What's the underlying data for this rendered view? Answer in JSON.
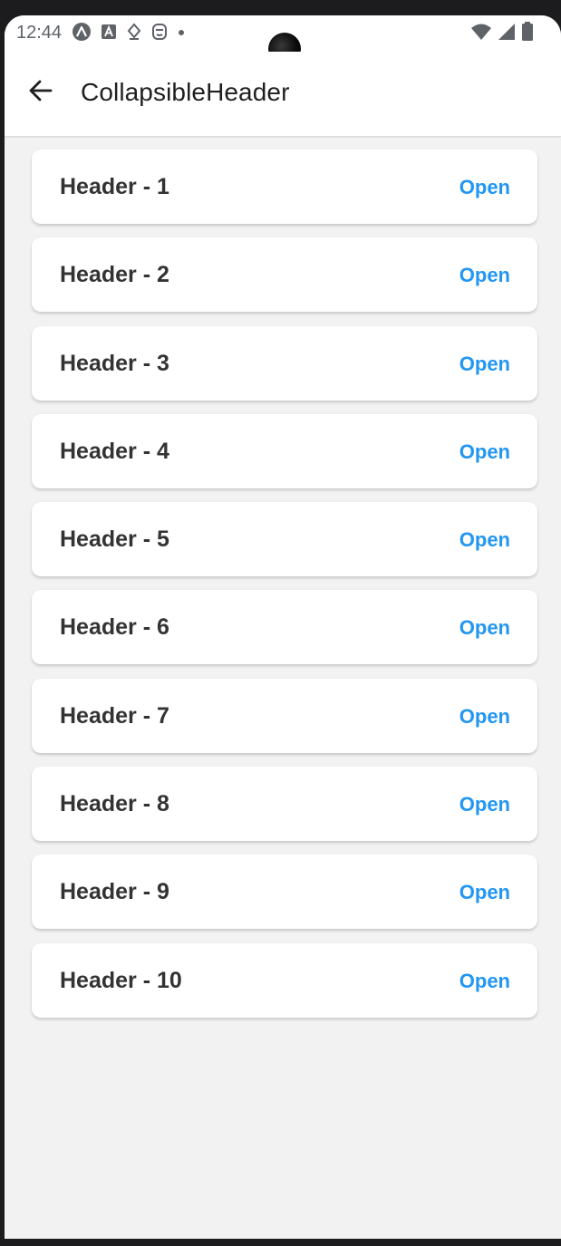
{
  "status_bar": {
    "time": "12:44",
    "left_icons": [
      "app-icon",
      "a-box-icon",
      "location-diamond-icon",
      "face-icon",
      "dot-icon"
    ],
    "right_icons": [
      "wifi-icon",
      "cell-signal-icon",
      "battery-icon"
    ]
  },
  "app_bar": {
    "back_icon": "arrow-left-icon",
    "title": "CollapsibleHeader"
  },
  "colors": {
    "accent": "#2196f3",
    "title_text": "#333333",
    "background": "#f2f2f2",
    "card": "#ffffff"
  },
  "list": {
    "items": [
      {
        "title": "Header - 1",
        "action": "Open"
      },
      {
        "title": "Header - 2",
        "action": "Open"
      },
      {
        "title": "Header - 3",
        "action": "Open"
      },
      {
        "title": "Header - 4",
        "action": "Open"
      },
      {
        "title": "Header - 5",
        "action": "Open"
      },
      {
        "title": "Header - 6",
        "action": "Open"
      },
      {
        "title": "Header - 7",
        "action": "Open"
      },
      {
        "title": "Header - 8",
        "action": "Open"
      },
      {
        "title": "Header - 9",
        "action": "Open"
      },
      {
        "title": "Header - 10",
        "action": "Open"
      }
    ]
  }
}
